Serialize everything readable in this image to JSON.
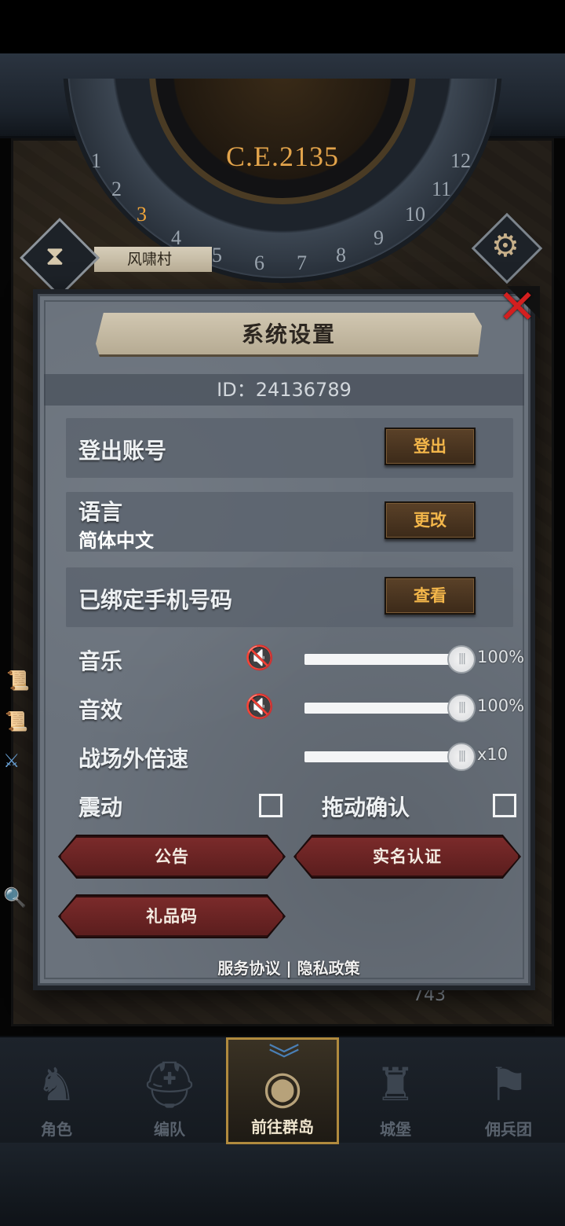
{
  "hud": {
    "year": "C.E.2135",
    "dial_numbers": [
      "1",
      "2",
      "3",
      "4",
      "5",
      "6",
      "7",
      "8",
      "9",
      "10",
      "11",
      "12"
    ],
    "active_number": "3",
    "village_name": "风啸村",
    "resource_value": "743"
  },
  "settings": {
    "title": "系统设置",
    "id_text": "ID：24136789",
    "rows": [
      {
        "label": "登出账号",
        "button": "登出"
      },
      {
        "label": "语言",
        "sub": "简体中文",
        "button": "更改"
      },
      {
        "label": "已绑定手机号码",
        "button": "查看"
      }
    ],
    "sliders": [
      {
        "label": "音乐",
        "value_text": "100%",
        "value": 100,
        "muted_icon": "speaker-muted-icon"
      },
      {
        "label": "音效",
        "value_text": "100%",
        "value": 100,
        "muted_icon": "speaker-muted-icon"
      },
      {
        "label": "战场外倍速",
        "value_text": "x10",
        "value": 100
      }
    ],
    "toggles": [
      {
        "label": "震动",
        "checked": false
      },
      {
        "label": "拖动确认",
        "checked": false
      }
    ],
    "buttons": {
      "announcement": "公告",
      "realname": "实名认证",
      "gift_code": "礼品码"
    },
    "footer": {
      "service": "服务协议",
      "separator": "|",
      "privacy": "隐私政策"
    }
  },
  "nav": {
    "items": [
      {
        "label": "角色",
        "icon": "knight-icon"
      },
      {
        "label": "编队",
        "icon": "helmet-icon"
      },
      {
        "label": "前往群岛",
        "icon": "globe-icon",
        "active": true
      },
      {
        "label": "城堡",
        "icon": "castle-icon"
      },
      {
        "label": "佣兵团",
        "icon": "banner-icon"
      }
    ]
  },
  "colors": {
    "panel": "#6a727c",
    "close": "#d31f1f",
    "gold_text": "#f3b64a",
    "red_button": "#7c2b2b",
    "active_border": "#b08a3e"
  }
}
